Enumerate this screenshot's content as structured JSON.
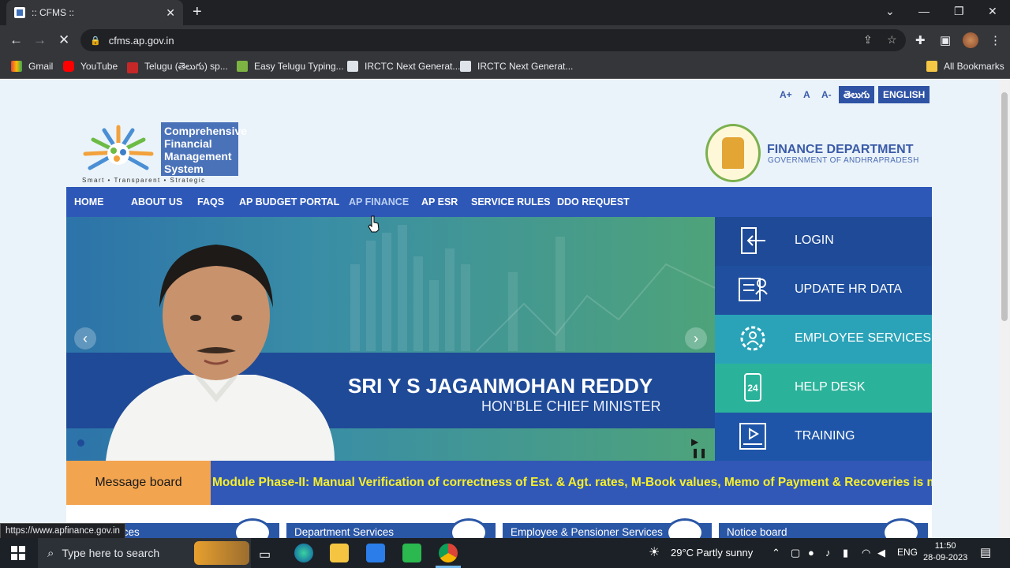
{
  "browser": {
    "tab_title": ":: CFMS ::",
    "url": "cfms.ap.gov.in",
    "bookmarks": [
      "Gmail",
      "YouTube",
      "Telugu (తెలుగు) sp...",
      "Easy Telugu Typing...",
      "IRCTC Next Generat...",
      "IRCTC Next Generat..."
    ],
    "all_bookmarks": "All Bookmarks",
    "status_url": "https://www.apfinance.gov.in"
  },
  "header": {
    "font_controls": [
      "A+",
      "A",
      "A-"
    ],
    "lang_telugu": "తెలుగు",
    "lang_english": "ENGLISH",
    "logo_text_lines": [
      "Comprehensive",
      "Financial",
      "Management",
      "System"
    ],
    "logo_tagline": "Smart • Transparent • Strategic",
    "dept_title": "FINANCE DEPARTMENT",
    "dept_subtitle": "GOVERNMENT OF ANDHRAPRADESH"
  },
  "menu": [
    "HOME",
    "ABOUT US",
    "FAQS",
    "AP BUDGET PORTAL",
    "AP FINANCE",
    "AP ESR",
    "SERVICE RULES",
    "DDO REQUEST"
  ],
  "slider": {
    "name": "SRI Y S JAGANMOHAN REDDY",
    "title": "HON'BLE CHIEF MINISTER"
  },
  "side_links": [
    "LOGIN",
    "UPDATE HR DATA",
    "EMPLOYEE SERVICES",
    "HELP DESK",
    "TRAINING"
  ],
  "message_board": {
    "label": "Message board",
    "ticker": "Module Phase-II: Manual Verification of correctness of Est. & Agt. rates, M-Book values, Memo of Payment & Recoveries is mandator"
  },
  "cards": [
    "ervices",
    "Department Services",
    "Employee & Pensioner Services",
    "Notice board"
  ],
  "taskbar": {
    "search_placeholder": "Type here to search",
    "weather": "29°C  Partly sunny",
    "lang": "ENG",
    "time": "11:50",
    "date": "28-09-2023"
  },
  "colors": {
    "nav_blue": "#2e58b8",
    "message_orange": "#f2a44f",
    "ticker_yellow": "#f7ef2a",
    "side_dark_blue": "#1f4a97",
    "side_teal": "#2aa3b8",
    "side_green": "#2ab39a"
  }
}
